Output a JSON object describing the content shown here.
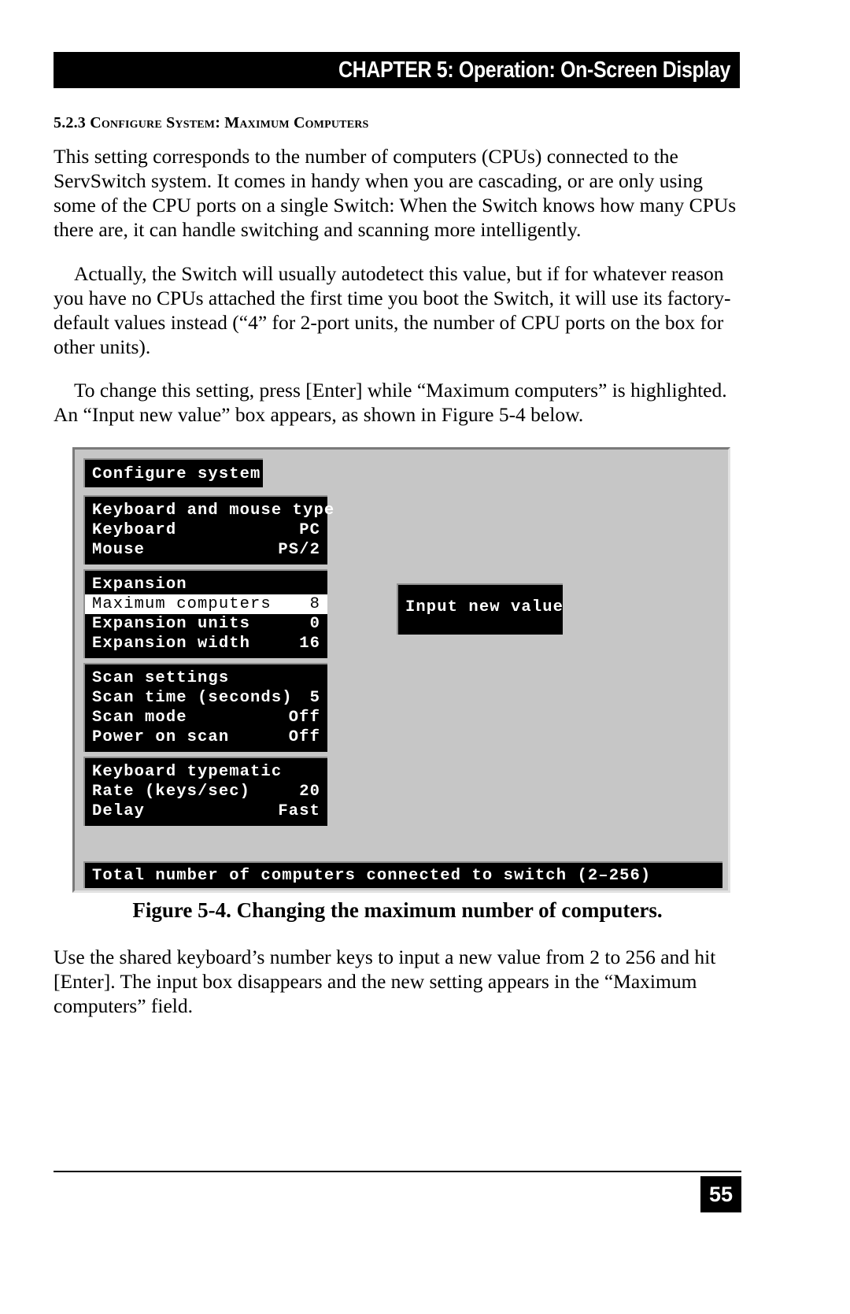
{
  "header": {
    "running_title": "CHAPTER 5: Operation: On-Screen Display"
  },
  "section": {
    "heading": "5.2.3 Configure System: Maximum Computers"
  },
  "paragraphs": {
    "p1": "This setting corresponds to the number of computers (CPUs) connected to the ServSwitch system. It comes in handy when you are cascading, or are only using some of the CPU ports on a single Switch: When the Switch knows how many CPUs there are, it can handle switching and scanning more intelligently.",
    "p2": "Actually, the Switch will usually autodetect this value, but if for whatever reason you have no CPUs attached the first time you boot the Switch, it will use its factory-default values instead (“4” for 2-port units, the number of CPU ports on the box for other units).",
    "p3": "To change this setting, press [Enter] while “Maximum computers” is highlighted. An “Input new value” box appears, as shown in Figure 5-4 below.",
    "p4": "Use the shared keyboard’s number keys to input a new value from 2 to 256 and hit [Enter]. The input box disappears and the new setting appears in the “Maximum computers” field."
  },
  "figure": {
    "caption": "Figure 5-4. Changing the maximum number of computers.",
    "colors": {
      "screen_background": "#c6c6c6",
      "panel_background": "#000000",
      "panel_text": "#ffffff",
      "highlight_background": "#ffffff",
      "highlight_text": "#000000"
    },
    "osd": {
      "title": "Configure system",
      "groups": [
        {
          "name": "keyboard-and-mouse-type",
          "heading": "Keyboard and mouse type",
          "rows": [
            {
              "label": "Keyboard",
              "value": "PC",
              "selected": false
            },
            {
              "label": "Mouse",
              "value": "PS/2",
              "selected": false
            }
          ]
        },
        {
          "name": "expansion",
          "heading": "Expansion",
          "rows": [
            {
              "label": "Maximum computers",
              "value": "8",
              "selected": true
            },
            {
              "label": "Expansion units",
              "value": "0",
              "selected": false
            },
            {
              "label": "Expansion width",
              "value": "16",
              "selected": false
            }
          ]
        },
        {
          "name": "scan-settings",
          "heading": "Scan settings",
          "rows": [
            {
              "label": "Scan time (seconds)",
              "value": "5",
              "selected": false
            },
            {
              "label": "Scan mode",
              "value": "Off",
              "selected": false
            },
            {
              "label": "Power on scan",
              "value": "Off",
              "selected": false
            }
          ]
        },
        {
          "name": "keyboard-typematic",
          "heading": "Keyboard typematic",
          "rows": [
            {
              "label": "Rate (keys/sec)",
              "value": "20",
              "selected": false
            },
            {
              "label": "Delay",
              "value": "Fast",
              "selected": false
            }
          ]
        }
      ],
      "dialog": {
        "title": "Input new value",
        "value": ""
      },
      "status_bar": "Total number of computers connected to switch (2–256)"
    }
  },
  "footer": {
    "page_number": "55"
  }
}
